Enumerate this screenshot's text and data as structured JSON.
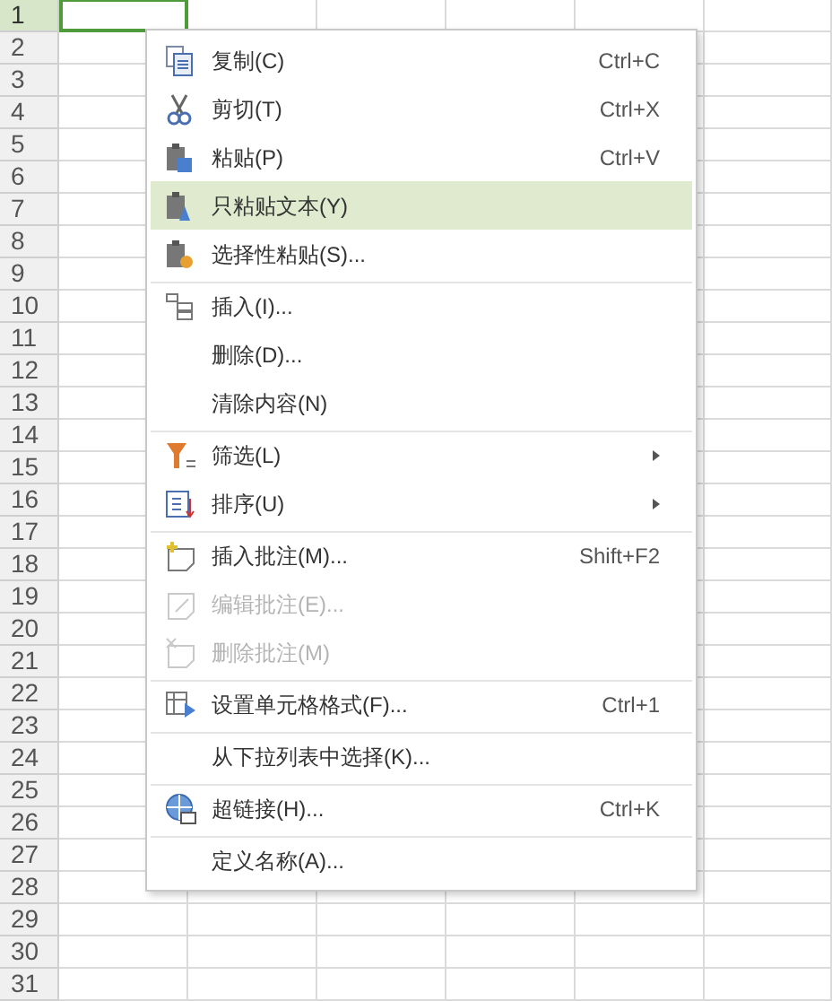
{
  "sheet": {
    "rows": [
      {
        "number": "1",
        "selected": true
      },
      {
        "number": "2",
        "selected": false
      },
      {
        "number": "3",
        "selected": false
      },
      {
        "number": "4",
        "selected": false
      },
      {
        "number": "5",
        "selected": false
      },
      {
        "number": "6",
        "selected": false
      },
      {
        "number": "7",
        "selected": false
      },
      {
        "number": "8",
        "selected": false
      },
      {
        "number": "9",
        "selected": false
      },
      {
        "number": "10",
        "selected": false
      },
      {
        "number": "11",
        "selected": false
      },
      {
        "number": "12",
        "selected": false
      },
      {
        "number": "13",
        "selected": false
      },
      {
        "number": "14",
        "selected": false
      },
      {
        "number": "15",
        "selected": false
      },
      {
        "number": "16",
        "selected": false
      },
      {
        "number": "17",
        "selected": false
      },
      {
        "number": "18",
        "selected": false
      },
      {
        "number": "19",
        "selected": false
      },
      {
        "number": "20",
        "selected": false
      },
      {
        "number": "21",
        "selected": false
      },
      {
        "number": "22",
        "selected": false
      },
      {
        "number": "23",
        "selected": false
      },
      {
        "number": "24",
        "selected": false
      },
      {
        "number": "25",
        "selected": false
      },
      {
        "number": "26",
        "selected": false
      },
      {
        "number": "27",
        "selected": false
      },
      {
        "number": "28",
        "selected": false
      },
      {
        "number": "29",
        "selected": false
      },
      {
        "number": "30",
        "selected": false
      },
      {
        "number": "31",
        "selected": false
      }
    ]
  },
  "context_menu": {
    "items": [
      {
        "label": "复制(C)",
        "shortcut": "Ctrl+C",
        "selected": false,
        "disabled": false,
        "submenu": false,
        "separator_before": false
      },
      {
        "label": "剪切(T)",
        "shortcut": "Ctrl+X",
        "selected": false,
        "disabled": false,
        "submenu": false,
        "separator_before": false
      },
      {
        "label": "粘贴(P)",
        "shortcut": "Ctrl+V",
        "selected": false,
        "disabled": false,
        "submenu": false,
        "separator_before": false
      },
      {
        "label": "只粘贴文本(Y)",
        "selected": true,
        "disabled": false,
        "submenu": false,
        "separator_before": false
      },
      {
        "label": "选择性粘贴(S)...",
        "selected": false,
        "disabled": false,
        "submenu": false,
        "separator_before": false
      },
      {
        "label": "插入(I)...",
        "selected": false,
        "disabled": false,
        "submenu": false,
        "separator_before": true
      },
      {
        "label": "删除(D)...",
        "selected": false,
        "disabled": false,
        "submenu": false,
        "separator_before": false
      },
      {
        "label": "清除内容(N)",
        "selected": false,
        "disabled": false,
        "submenu": false,
        "separator_before": false
      },
      {
        "label": "筛选(L)",
        "selected": false,
        "disabled": false,
        "submenu": true,
        "separator_before": true
      },
      {
        "label": "排序(U)",
        "selected": false,
        "disabled": false,
        "submenu": true,
        "separator_before": false
      },
      {
        "label": "插入批注(M)...",
        "shortcut": "Shift+F2",
        "selected": false,
        "disabled": false,
        "submenu": false,
        "separator_before": true
      },
      {
        "label": "编辑批注(E)...",
        "selected": false,
        "disabled": true,
        "submenu": false,
        "separator_before": false
      },
      {
        "label": "删除批注(M)",
        "selected": false,
        "disabled": true,
        "submenu": false,
        "separator_before": false
      },
      {
        "label": "设置单元格格式(F)...",
        "shortcut": "Ctrl+1",
        "selected": false,
        "disabled": false,
        "submenu": false,
        "separator_before": true
      },
      {
        "label": "从下拉列表中选择(K)...",
        "selected": false,
        "disabled": false,
        "submenu": false,
        "separator_before": true
      },
      {
        "label": "超链接(H)...",
        "shortcut": "Ctrl+K",
        "selected": false,
        "disabled": false,
        "submenu": false,
        "separator_before": true
      },
      {
        "label": "定义名称(A)...",
        "selected": false,
        "disabled": false,
        "submenu": false,
        "separator_before": true
      }
    ]
  }
}
